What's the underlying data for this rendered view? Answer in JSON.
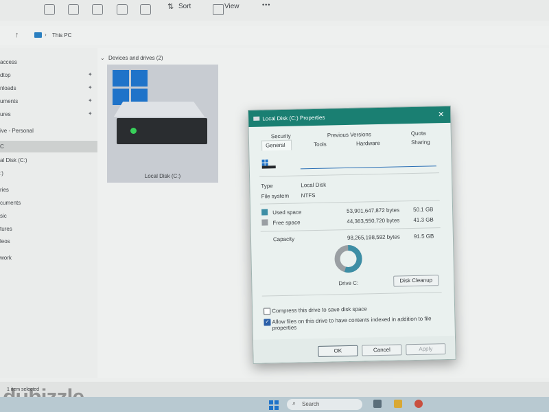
{
  "toolbar": {
    "sort_label": "Sort",
    "view_label": "View",
    "more_label": "•••"
  },
  "address": {
    "path": "This PC"
  },
  "sidebar": {
    "items": [
      "access",
      "dtop",
      "nloads",
      "uments",
      "ures",
      "ive - Personal",
      "C",
      "al Disk (C:)",
      ":)",
      "ries",
      "cuments",
      "sic",
      "tures",
      "leos",
      "work"
    ]
  },
  "main": {
    "section_title": "Devices and drives (2)",
    "drive_label": "Local Disk (C:)"
  },
  "status": {
    "text": "1 item selected"
  },
  "taskbar": {
    "search_label": "Search"
  },
  "watermark": {
    "text": "dubizzle"
  },
  "dialog": {
    "title": "Local Disk (C:) Properties",
    "tabs_row1": [
      "Security",
      "Previous Versions",
      "Quota"
    ],
    "tabs_row2": [
      "General",
      "Tools",
      "Hardware",
      "Sharing"
    ],
    "name_value": "",
    "type_label": "Type",
    "type_value": "Local Disk",
    "fs_label": "File system",
    "fs_value": "NTFS",
    "used": {
      "label": "Used space",
      "bytes": "53,901,647,872 bytes",
      "size": "50.1 GB",
      "color": "#3d8ea5"
    },
    "free": {
      "label": "Free space",
      "bytes": "44,363,550,720 bytes",
      "size": "41.3 GB",
      "color": "#9a9fa3"
    },
    "capacity": {
      "label": "Capacity",
      "bytes": "98,265,198,592 bytes",
      "size": "91.5 GB"
    },
    "used_fraction": 0.548,
    "drive_caption": "Drive C:",
    "cleanup_label": "Disk Cleanup",
    "compress_label": "Compress this drive to save disk space",
    "compress_checked": false,
    "index_label_1": "Allow files on this drive to have contents indexed in addition to file",
    "index_label_2": "properties",
    "index_checked": true,
    "ok_label": "OK",
    "cancel_label": "Cancel",
    "apply_label": "Apply"
  },
  "colors": {
    "accent": "#1a7f72",
    "win_blue": "#1f73c9",
    "led_green": "#38d05a"
  }
}
